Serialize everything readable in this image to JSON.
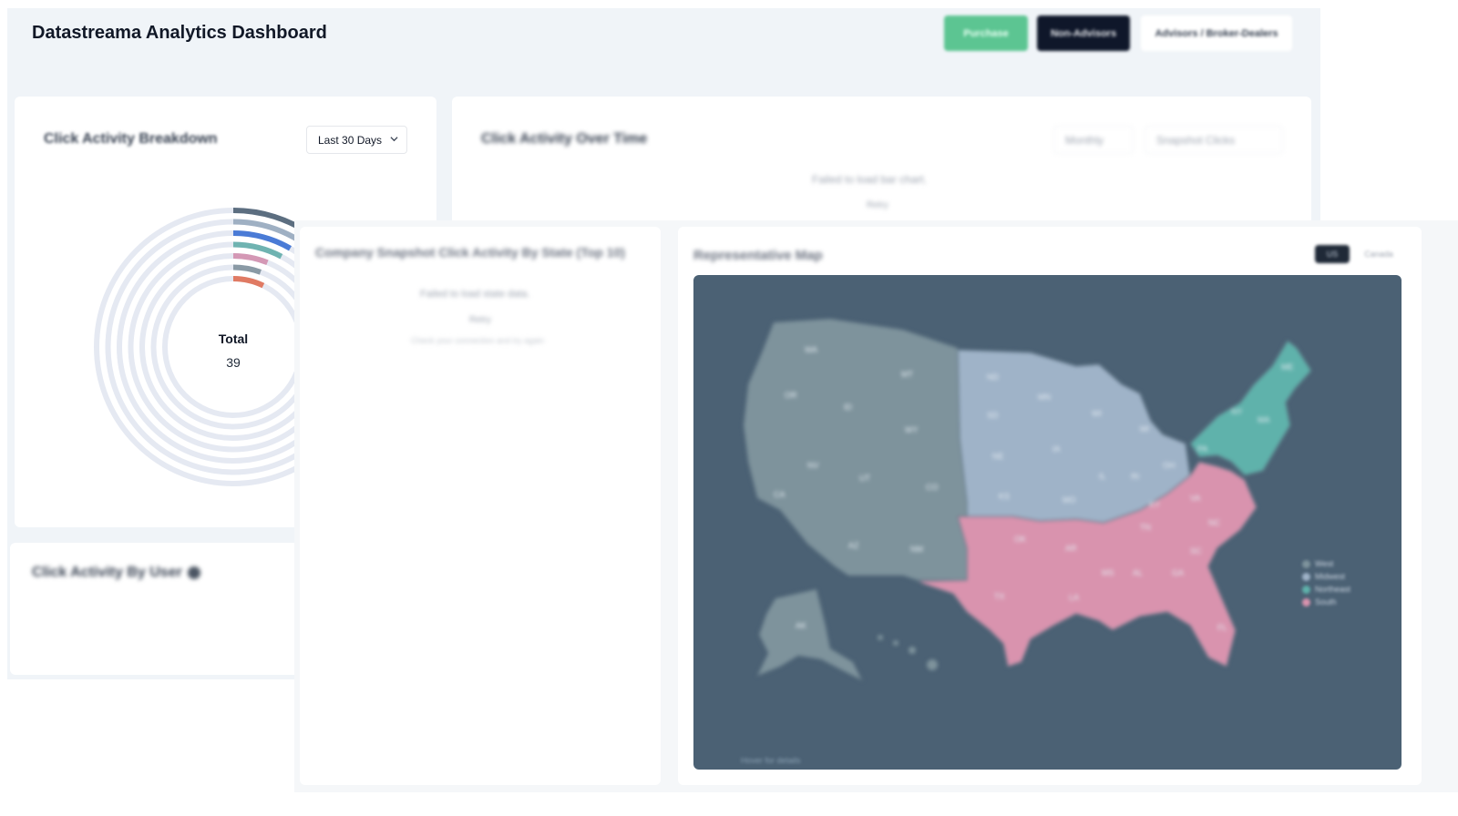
{
  "header": {
    "title": "Datastreama Analytics Dashboard",
    "purchase_label": "Purchase",
    "non_advisors_label": "Non-Advisors",
    "advisors_label": "Advisors / Broker-Dealers"
  },
  "breakdown": {
    "title": "Click Activity Breakdown",
    "range_selected": "Last 30 Days",
    "total_label": "Total",
    "total_value": "39",
    "ring_colors": [
      "#5c6e80",
      "#9fb0c3",
      "#4a7bd6",
      "#6fb3b1",
      "#d498b5",
      "#8a9aa5",
      "#e07a63"
    ]
  },
  "over_time": {
    "title": "Click Activity Over Time",
    "period_selected": "Monthly",
    "metric_selected": "Snapshot Clicks",
    "error_text": "Failed to load bar chart.",
    "retry_label": "Retry"
  },
  "by_user": {
    "title": "Click Activity By User"
  },
  "state_card": {
    "title": "Company Snapshot Click Activity By State (Top 10)",
    "error_text": "Failed to load state data.",
    "retry_label": "Retry",
    "hint_text": "Check your connection and try again"
  },
  "map_card": {
    "title": "Representative Map",
    "toggle_on_label": "US",
    "toggle_off_label": "Canada",
    "footer_note": "Hover for details",
    "region_colors": {
      "west": "#7e939c",
      "midwest": "#9fb3c8",
      "northeast": "#5fb2ab",
      "south": "#d993ae"
    },
    "legend": [
      "West",
      "Midwest",
      "Northeast",
      "South"
    ]
  }
}
